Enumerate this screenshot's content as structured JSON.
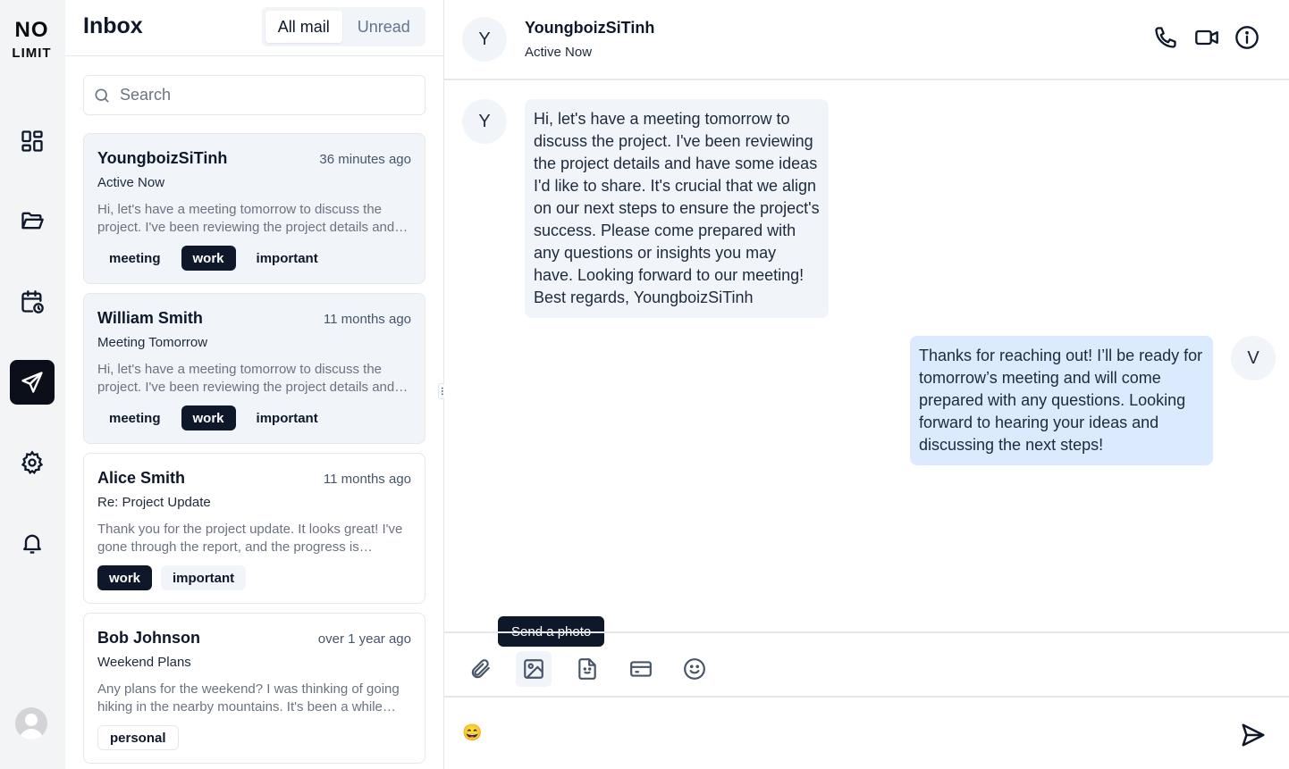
{
  "brand": {
    "line1": "NO",
    "line2": "LIMIT"
  },
  "rail": {
    "items": [
      {
        "icon": "dashboard-icon"
      },
      {
        "icon": "folder-icon"
      },
      {
        "icon": "calendar-clock-icon"
      },
      {
        "icon": "send-icon",
        "active": true
      },
      {
        "icon": "gear-icon"
      },
      {
        "icon": "bell-icon"
      }
    ],
    "user_avatar_icon": "user-avatar-icon"
  },
  "inbox": {
    "title": "Inbox",
    "tabs": [
      {
        "label": "All mail",
        "active": true
      },
      {
        "label": "Unread",
        "active": false
      }
    ],
    "search": {
      "placeholder": "Search",
      "value": ""
    },
    "mails": [
      {
        "from": "YoungboizSiTinh",
        "time": "36 minutes ago",
        "subject": "Active Now",
        "preview": "Hi, let's have a meeting tomorrow to discuss the project. I've been reviewing the project details and have some ideas I'd like to share. It's crucial that we align on our next steps to ensure the project's success.",
        "tags": [
          "meeting",
          "work",
          "important"
        ],
        "selected": true
      },
      {
        "from": "William Smith",
        "time": "11 months ago",
        "subject": "Meeting Tomorrow",
        "preview": "Hi, let's have a meeting tomorrow to discuss the project. I've been reviewing the project details and have some ideas I'd like to share.",
        "tags": [
          "meeting",
          "work",
          "important"
        ],
        "selected": true
      },
      {
        "from": "Alice Smith",
        "time": "11 months ago",
        "subject": "Re: Project Update",
        "preview": "Thank you for the project update. It looks great! I've gone through the report, and the progress is impressive.",
        "tags": [
          "work",
          "important"
        ],
        "selected": false
      },
      {
        "from": "Bob Johnson",
        "time": "over 1 year ago",
        "subject": "Weekend Plans",
        "preview": "Any plans for the weekend? I was thinking of going hiking in the nearby mountains. It's been a while since we had some outdoor fun.",
        "tags": [
          "personal"
        ],
        "selected": false
      }
    ]
  },
  "chat": {
    "contact": {
      "initial": "Y",
      "name": "YoungboizSiTinh",
      "status": "Active Now"
    },
    "header_icons": [
      "phone-icon",
      "video-icon",
      "info-icon"
    ],
    "messages": [
      {
        "direction": "in",
        "initial": "Y",
        "text": "Hi, let's have a meeting tomorrow to discuss the project. I've been reviewing the project details and have some ideas I'd like to share. It's crucial that we align on our next steps to ensure the project's success. Please come prepared with any questions or insights you may have. Looking forward to our meeting! Best regards, YoungboizSiTinh"
      },
      {
        "direction": "out",
        "initial": "V",
        "text": "Thanks for reaching out! I’ll be ready for tomorrow’s meeting and will come prepared with any questions. Looking forward to hearing your ideas and discussing the next steps!"
      }
    ],
    "tooltip": "Send a photo",
    "tools": [
      "paperclip-icon",
      "image-icon",
      "file-icon",
      "card-icon",
      "smile-icon"
    ],
    "composer": {
      "value": "😄"
    }
  },
  "colors": {
    "dark": "#0f172a",
    "bubble_in": "#f1f5f9",
    "bubble_out": "#dbeafe",
    "rail_bg": "#f3f4f6"
  }
}
